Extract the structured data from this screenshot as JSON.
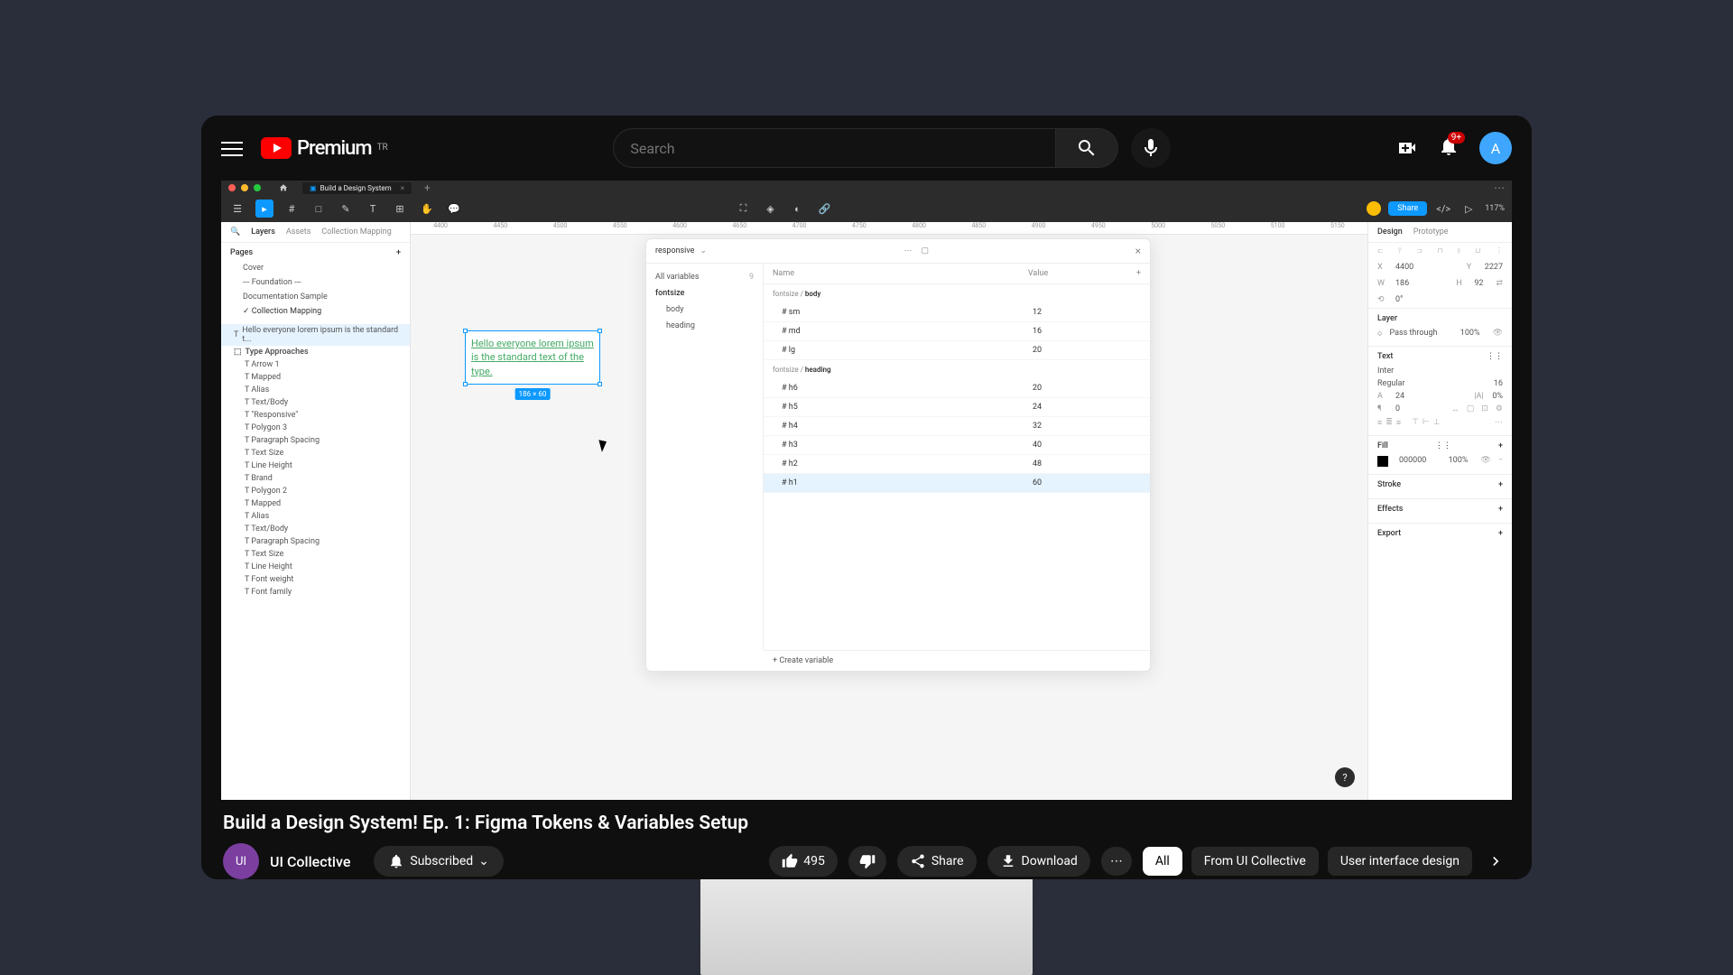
{
  "yt": {
    "brand": "Premium",
    "brand_sup": "TR",
    "search_placeholder": "Search",
    "notif_badge": "9+",
    "avatar_letter": "A"
  },
  "video": {
    "title": "Build a Design System! Ep. 1: Figma Tokens & Variables Setup",
    "channel": "UI Collective",
    "channel_initials": "UI",
    "subscribed": "Subscribed",
    "likes": "495",
    "share": "Share",
    "download": "Download"
  },
  "chips": [
    "All",
    "From UI Collective",
    "User interface design"
  ],
  "figma": {
    "tab": "Build a Design System",
    "zoom": "117%",
    "share": "Share",
    "left_tabs": [
      "Layers",
      "Assets",
      "Collection Mapping"
    ],
    "pages_hdr": "Pages",
    "pages": [
      "Cover",
      "--- Foundation ---",
      "Documentation Sample",
      "Collection Mapping"
    ],
    "sel_layer": "Hello everyone lorem ipsum is the standard t...",
    "group_layer": "Type Approaches",
    "layers": [
      "Arrow 1",
      "Mapped",
      "Alias",
      "Text/Body",
      "\"Responsive\"",
      "Polygon 3",
      "Paragraph Spacing",
      "Text Size",
      "Line Height",
      "Brand",
      "Polygon 2",
      "Mapped",
      "Alias",
      "Text/Body",
      "Paragraph Spacing",
      "Text Size",
      "Line Height",
      "Font weight",
      "Font family"
    ],
    "ruler": [
      "4400",
      "4450",
      "4500",
      "4550",
      "4600",
      "4650",
      "4700",
      "4750",
      "4800",
      "4850",
      "4900",
      "4950",
      "5000",
      "5050",
      "5100",
      "5150"
    ],
    "textbox": "Hello everyone lorem ipsum is the standard text of the type.",
    "size_tag": "186 × 60",
    "vp": {
      "title": "responsive",
      "all_vars": "All variables",
      "all_count": "9",
      "group": "fontsize",
      "subs": [
        "body",
        "heading"
      ],
      "col_name": "Name",
      "col_value": "Value",
      "g1": "fontsize / ",
      "g1b": "body",
      "rows1": [
        [
          "sm",
          "12"
        ],
        [
          "md",
          "16"
        ],
        [
          "lg",
          "20"
        ]
      ],
      "g2": "fontsize / ",
      "g2b": "heading",
      "rows2": [
        [
          "h6",
          "20"
        ],
        [
          "h5",
          "24"
        ],
        [
          "h4",
          "32"
        ],
        [
          "h3",
          "40"
        ],
        [
          "h2",
          "48"
        ],
        [
          "h1",
          "60"
        ]
      ],
      "create": "Create variable"
    },
    "right": {
      "tabs": [
        "Design",
        "Prototype"
      ],
      "x": "4400",
      "y": "2227",
      "w": "186",
      "h": "92",
      "rot": "0°",
      "layer_hdr": "Layer",
      "pass": "Pass through",
      "opacity": "100%",
      "text_hdr": "Text",
      "font": "Inter",
      "weight": "Regular",
      "size": "16",
      "fs": "24",
      "lh": "0%",
      "ls": "0",
      "fill_hdr": "Fill",
      "fill_hex": "000000",
      "fill_op": "100%",
      "stroke_hdr": "Stroke",
      "effects_hdr": "Effects",
      "export_hdr": "Export"
    }
  }
}
